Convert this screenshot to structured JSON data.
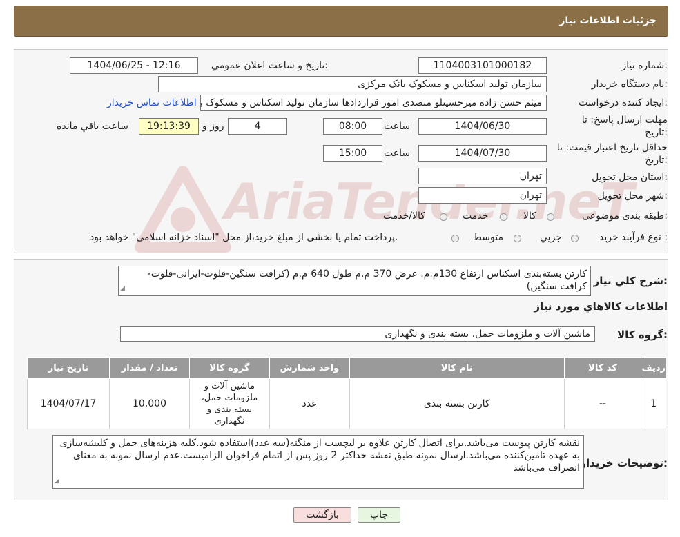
{
  "header": {
    "title": "جزئیات اطلاعات نیاز"
  },
  "need_number": {
    "label": "شماره نیاز:",
    "value": "1104003101000182"
  },
  "announce": {
    "label": "تاریخ و ساعت اعلان عمومي:",
    "value": "1404/06/25 - 12:16"
  },
  "buyer": {
    "label": "نام دستگاه خريدار:",
    "value": "سازمان تولید اسکناس و مسکوک بانک مرکزی"
  },
  "requester": {
    "label": "ايجاد كننده درخواست:",
    "value": "میثم حسن زاده میرحسینلو متصدی امور قراردادها سازمان تولید اسکناس و مسکوک بانک مرکزی",
    "contact_link": "اطلاعات تماس خريدار"
  },
  "deadline": {
    "label_line1": "مهلت ارسال پاسخ: تا",
    "label_line2": "تاريخ:",
    "date": "1404/06/30",
    "time_label": "ساعت",
    "time": "08:00",
    "days": "4",
    "days_label": "روز و",
    "remaining": "19:13:39",
    "remaining_label": "ساعت باقي مانده"
  },
  "price_validity": {
    "label_line1": "حداقل تاريخ اعتبار قيمت: تا",
    "label_line2": "تاريخ:",
    "date": "1404/07/30",
    "time_label": "ساعت",
    "time": "15:00"
  },
  "province": {
    "label": "استان محل تحويل:",
    "value": "تهران"
  },
  "city": {
    "label": "شهر محل تحويل:",
    "value": "تهران"
  },
  "category": {
    "label": "طبقه بندی موضوعی:",
    "options": [
      "كالا",
      "خدمت",
      "كالا/خدمت"
    ]
  },
  "process": {
    "label": "نوع فرآيند خريد :",
    "options": [
      "جزيي",
      "متوسط"
    ],
    "note": "پرداخت تمام يا بخشی از مبلغ خريد،از محل \"اسناد خزانه اسلامی\" خواهد بود."
  },
  "watermark": {
    "text": "AriaTender.neT"
  },
  "summary": {
    "label": "شرح كلي نياز:",
    "value": "كارتن بسته‌بندی اسكناس ارتفاع 130م.م. عرض 370 م.م طول 640 م.م (كرافت سنگين-فلوت-ايرانی-فلوت-كرافت سنگين)"
  },
  "goods_info_title": "اطلاعات كالاهاي مورد نياز",
  "goods_group": {
    "label": "گروه كالا:",
    "value": "ماشين آلات و ملزومات حمل، بسته بندی و نگهداری"
  },
  "table": {
    "headers": [
      "رديف",
      "كد كالا",
      "نام كالا",
      "واحد شمارش",
      "گروه كالا",
      "تعداد / مقدار",
      "تاريخ نياز"
    ],
    "rows": [
      {
        "row": "1",
        "code": "--",
        "name": "كارتن بسته بندی",
        "unit": "عدد",
        "group": "ماشين آلات و ملزومات حمل، بسته بندی و نگهداری",
        "qty": "10,000",
        "date": "1404/07/17"
      }
    ]
  },
  "buyer_notes": {
    "label": "توضيحات خريدار:",
    "value": "نقشه كارتن پيوست می‌باشد.برای اتصال كارتن علاوه بر ليچسب از منگنه(سه عدد)استفاده شود.كليه هزينه‌های حمل و كليشه‌سازی به عهده تامين‌كننده می‌باشد.ارسال نمونه طبق نقشه حداكثر 2 روز پس از اتمام فراخوان الزاميست.عدم ارسال نمونه به معنای انصراف می‌باشد"
  },
  "buttons": {
    "print": "چاپ",
    "back": "بازگشت"
  },
  "colors": {
    "header_bg": "#8b6f47",
    "table_header_bg": "#9a9a9a",
    "back_button_bg": "#f9dede",
    "print_button_bg": "#e6f6e0",
    "timer_bg": "#ffffc4",
    "link": "#1a4fd0"
  }
}
